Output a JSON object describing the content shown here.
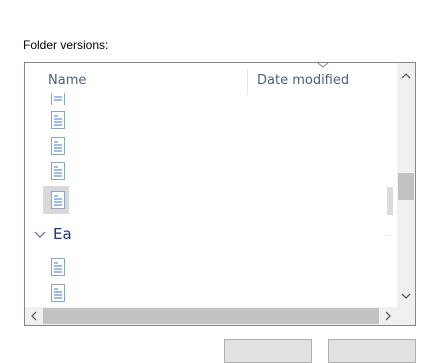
{
  "section_label": "Folder versions:",
  "columns": {
    "name": "Name",
    "date_modified": "Date modified"
  },
  "group": {
    "label": "Ea",
    "expanded": true
  },
  "icons": {
    "file": "document-file-icon",
    "sort": "chevron-down-icon",
    "group": "chevron-down-icon"
  },
  "colors": {
    "header_text": "#4c607a",
    "group_text": "#1e3287",
    "selection": "#d9d9d9"
  }
}
